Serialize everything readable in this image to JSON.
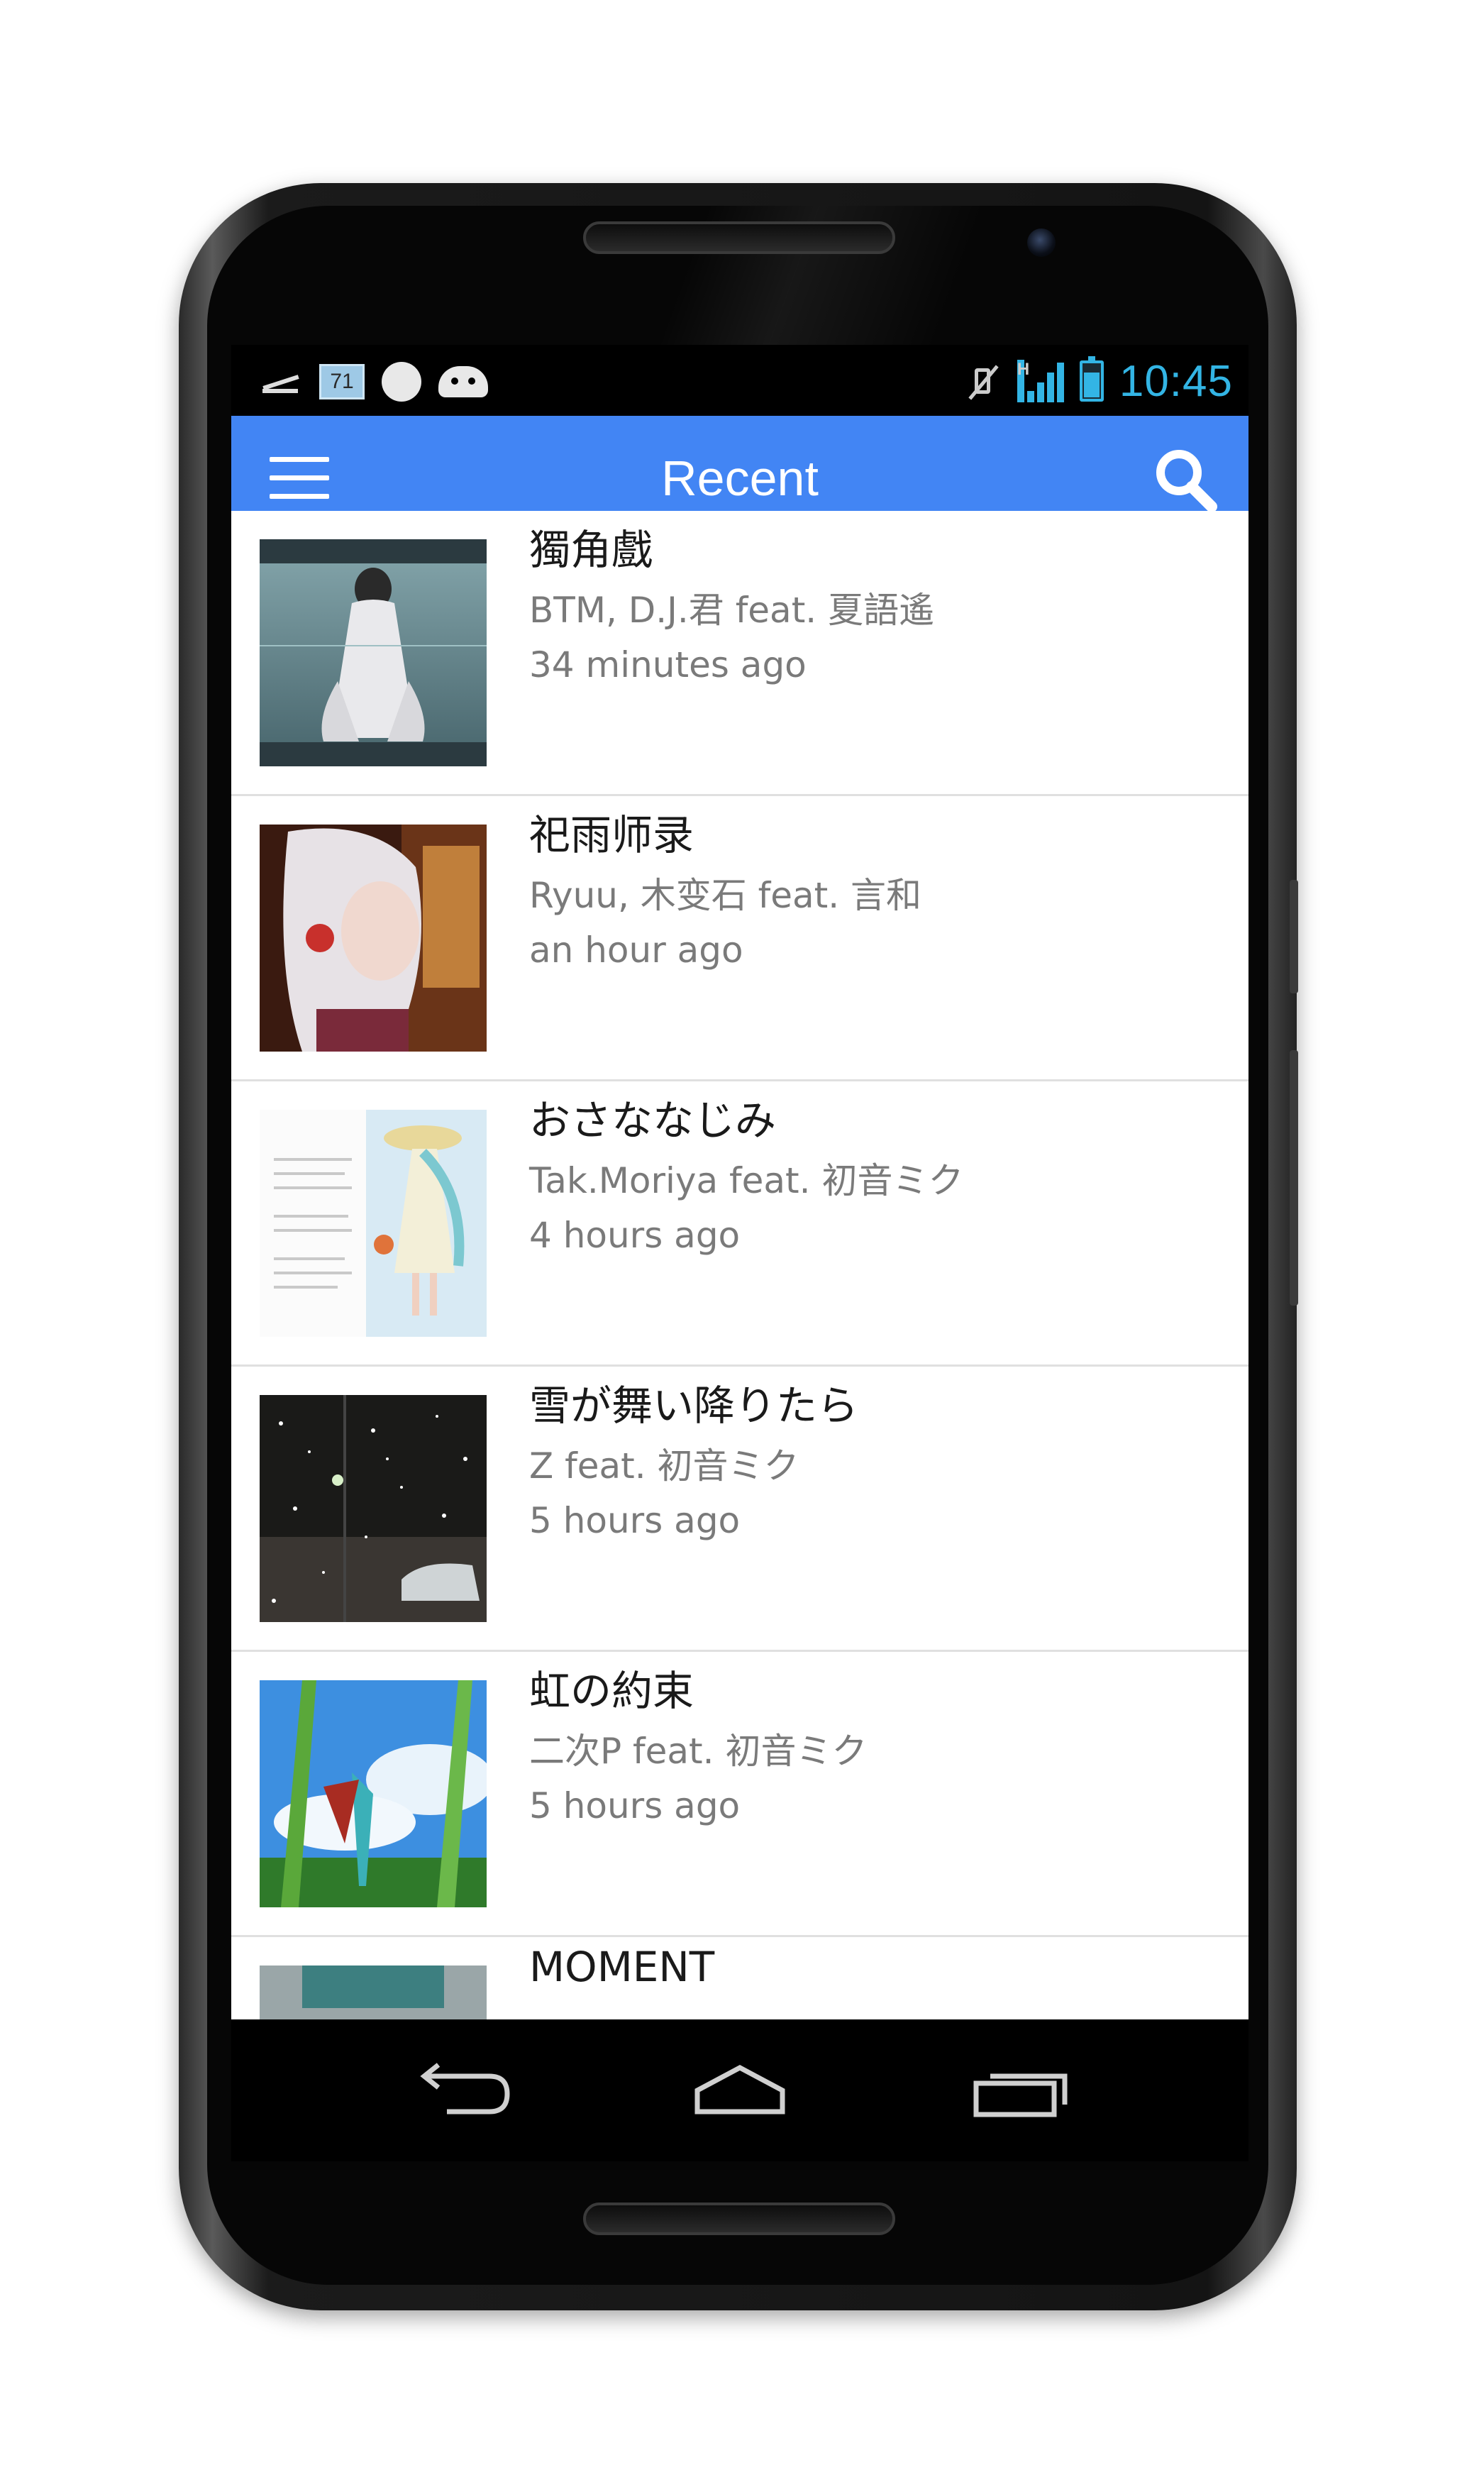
{
  "status_bar": {
    "time": "10:45",
    "notification_badge": "71",
    "signal_type": "H",
    "icons_left": [
      "z-icon",
      "gallery-badge-icon",
      "emoticon-icon",
      "android-icon"
    ],
    "icons_right": [
      "mute-icon",
      "signal-icon",
      "battery-charging-icon"
    ]
  },
  "app_bar": {
    "title": "Recent",
    "menu_icon": "hamburger-menu-icon",
    "search_icon": "search-icon",
    "color": "#4285f4"
  },
  "songs": [
    {
      "title": "獨角戲",
      "artist": "BTM, D.J.君 feat. 夏語遙",
      "time": "34 minutes ago"
    },
    {
      "title": "祀雨师录",
      "artist": "Ryuu, 木变石 feat. 言和",
      "time": "an hour ago"
    },
    {
      "title": "おさななじみ",
      "artist": "Tak.Moriya feat. 初音ミク",
      "time": "4 hours ago"
    },
    {
      "title": "雪が舞い降りたら",
      "artist": "Z feat. 初音ミク",
      "time": "5 hours ago"
    },
    {
      "title": "虹の約束",
      "artist": "二次P feat. 初音ミク",
      "time": "5 hours ago"
    },
    {
      "title": "MOMENT",
      "artist": "",
      "time": ""
    }
  ],
  "nav_bar": {
    "back_icon": "back-icon",
    "home_icon": "home-icon",
    "recents_icon": "recent-apps-icon"
  },
  "colors": {
    "status_accent": "#33b5e5",
    "divider": "#e0e0e0",
    "secondary_text": "#7a7a7a"
  }
}
